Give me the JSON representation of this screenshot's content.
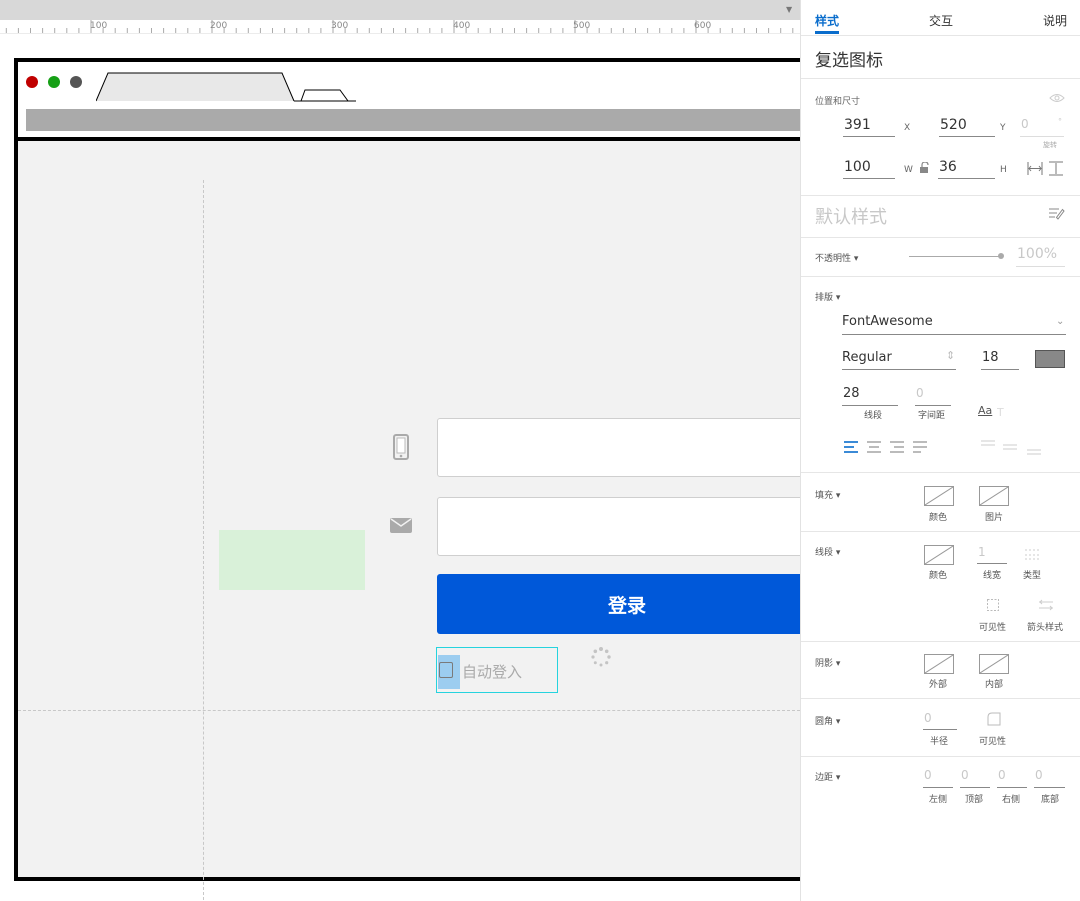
{
  "ruler": {
    "labels": [
      "100",
      "200",
      "300",
      "400",
      "500",
      "600"
    ]
  },
  "canvas": {
    "login_button_label": "登录",
    "auto_login_label": "自动登入"
  },
  "panel": {
    "tabs": [
      {
        "label": "样式",
        "active": true
      },
      {
        "label": "交互",
        "active": false
      },
      {
        "label": "说明",
        "active": false
      }
    ],
    "title": "复选图标",
    "position_size": {
      "section_label": "位置和尺寸",
      "x": "391",
      "x_label": "X",
      "y": "520",
      "y_label": "Y",
      "rotation": "0",
      "rotation_label": "旋转",
      "w": "100",
      "w_label": "W",
      "h": "36",
      "h_label": "H"
    },
    "default_style": "默认样式",
    "opacity": {
      "label": "不透明性 ▾",
      "value": "100%",
      "level": 100
    },
    "typography": {
      "label": "排版 ▾",
      "font": "FontAwesome",
      "weight": "Regular",
      "size": "18",
      "color": "#888888",
      "line_spacing": "28",
      "line_spacing_label": "线段",
      "char_spacing": "0",
      "char_spacing_label": "字间距",
      "aa_label": "Aa"
    },
    "fill": {
      "label": "填充 ▾",
      "color_label": "颜色",
      "image_label": "图片"
    },
    "border": {
      "label": "线段 ▾",
      "color_label": "颜色",
      "width": "1",
      "width_label": "线宽",
      "type_label": "类型",
      "visibility_label": "可见性",
      "arrow_label": "箭头样式"
    },
    "shadow": {
      "label": "阴影 ▾",
      "outer_label": "外部",
      "inner_label": "内部"
    },
    "corner": {
      "label": "圆角 ▾",
      "radius": "0",
      "radius_label": "半径",
      "visibility_label": "可见性"
    },
    "padding": {
      "label": "边距 ▾",
      "left": "0",
      "left_label": "左侧",
      "top": "0",
      "top_label": "顶部",
      "right": "0",
      "right_label": "右侧",
      "bottom": "0",
      "bottom_label": "底部"
    }
  },
  "colors": {
    "accent": "#0a6dcc",
    "login_button": "#0058d9",
    "selection": "#26d3de",
    "green_placeholder": "#d9f1d9",
    "traffic_red": "#c00000",
    "traffic_green": "#16a016",
    "traffic_grey": "#555555"
  }
}
